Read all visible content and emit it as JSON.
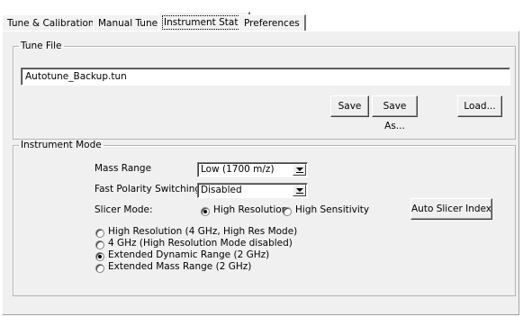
{
  "tabs": [
    {
      "label": "Tune & Calibration"
    },
    {
      "label": "Manual Tune"
    },
    {
      "label": "Instrument State"
    },
    {
      "label": "Preferences"
    }
  ],
  "tune_file": {
    "legend": "Tune File",
    "value": "Autotune_Backup.tun",
    "save_label": "Save",
    "save_as_label": "Save As...",
    "load_label": "Load..."
  },
  "instrument_mode": {
    "legend": "Instrument Mode",
    "mass_range_label": "Mass Range",
    "mass_range_value": "Low (1700 m/z)",
    "polarity_label": "Fast Polarity Switching",
    "polarity_value": "Disabled",
    "slicer_label": "Slicer Mode:",
    "slicer_options": [
      {
        "label": "High Resolution",
        "selected": true
      },
      {
        "label": "High Sensitivity",
        "selected": false
      }
    ],
    "auto_slicer_label": "Auto Slicer Index",
    "modes": [
      {
        "label": "High Resolution (4 GHz, High Res Mode)",
        "selected": false
      },
      {
        "label": "4 GHz (High Resolution Mode disabled)",
        "selected": false
      },
      {
        "label": "Extended Dynamic Range (2 GHz)",
        "selected": true
      },
      {
        "label": "Extended Mass Range (2 GHz)",
        "selected": false
      }
    ]
  }
}
